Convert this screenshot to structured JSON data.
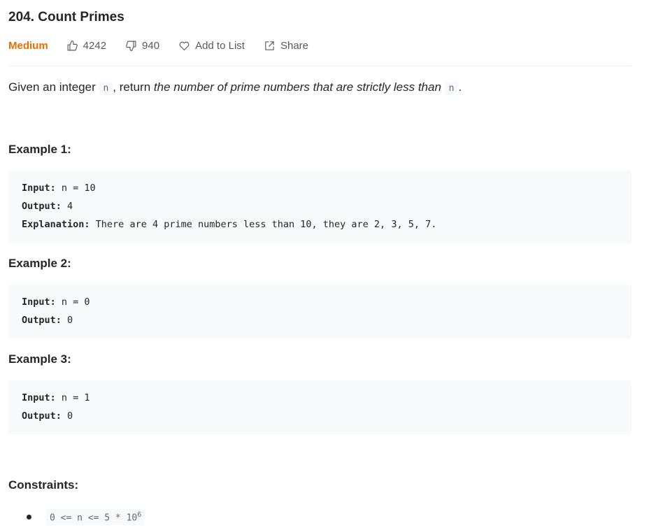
{
  "problem": {
    "title": "204. Count Primes",
    "difficulty": "Medium",
    "likes": "4242",
    "dislikes": "940",
    "add_to_list": "Add to List",
    "share": "Share"
  },
  "description": {
    "part1": "Given an integer ",
    "code1": "n",
    "part2": ", return ",
    "emphasis": "the number of prime numbers that are strictly less than",
    "code2": "n",
    "part3": "."
  },
  "examples": [
    {
      "heading": "Example 1:",
      "input_label": "Input:",
      "input_value": " n = 10",
      "output_label": "Output:",
      "output_value": " 4",
      "explanation_label": "Explanation:",
      "explanation_value": " There are 4 prime numbers less than 10, they are 2, 3, 5, 7."
    },
    {
      "heading": "Example 2:",
      "input_label": "Input:",
      "input_value": " n = 0",
      "output_label": "Output:",
      "output_value": " 0"
    },
    {
      "heading": "Example 3:",
      "input_label": "Input:",
      "input_value": " n = 1",
      "output_label": "Output:",
      "output_value": " 0"
    }
  ],
  "constraints": {
    "heading": "Constraints:",
    "item_base": "0 <= n <= 5 * 10",
    "item_exponent": "6"
  },
  "colors": {
    "difficulty_medium": "#ef6c00",
    "code_bg": "#f7f9fa",
    "text": "#262626"
  },
  "icons": [
    "thumbs-up-icon",
    "thumbs-down-icon",
    "heart-icon",
    "share-icon"
  ]
}
